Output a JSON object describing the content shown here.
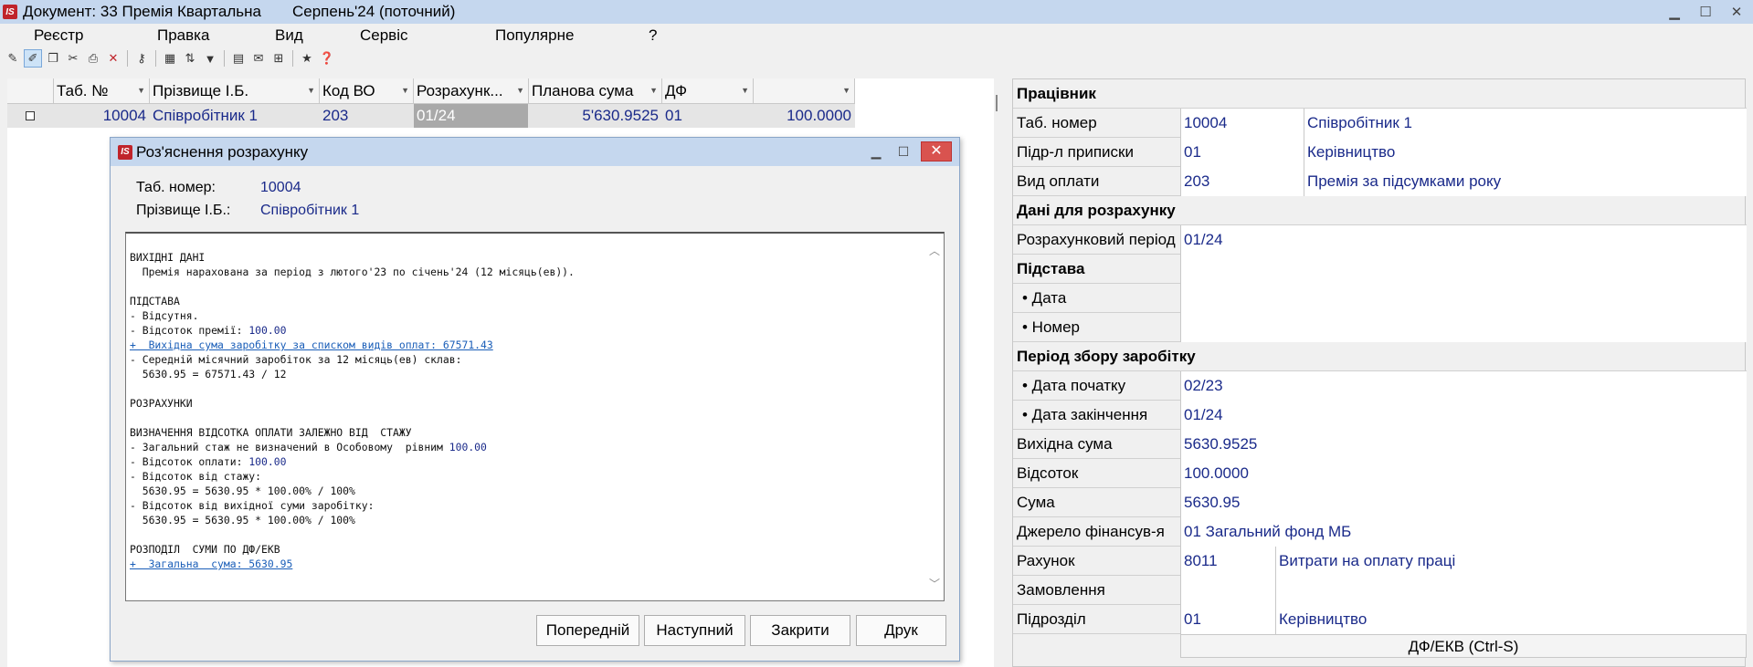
{
  "window": {
    "title": "Документ: 33 Премія Квартальна",
    "period": "Серпень'24 (поточний)",
    "logo_text": "IS"
  },
  "menu": [
    "Реєстр",
    "Правка",
    "Вид",
    "Сервіс",
    "Популярне",
    "?"
  ],
  "grid": {
    "headers": [
      "Таб. №",
      "Прізвище І.Б.",
      "Код ВО",
      "Розрахунк...",
      "Планова сума",
      "ДФ",
      ""
    ],
    "row": {
      "tab": "10004",
      "name": "Співробітник 1",
      "code": "203",
      "period": "01/24",
      "sum": "5'630.9525",
      "df": "01",
      "percent": "100.0000"
    }
  },
  "dialog": {
    "title": "Роз'яснення розрахунку",
    "tab_label": "Таб. номер:",
    "tab_value": "10004",
    "name_label": "Прізвище І.Б.:",
    "name_value": "Співробітник 1",
    "lines": [
      {
        "t": "ВИХІДНІ ДАНІ"
      },
      {
        "t": "  Премія нарахована за період з лютого'23 по січень'24 (12 місяць(ев))."
      },
      {
        "t": ""
      },
      {
        "t": "ПІДСТАВА"
      },
      {
        "t": "- Відсутня."
      },
      {
        "t": "- Відсоток премії: ",
        "n": "100.00"
      },
      {
        "t": "+  Вихідна сума заробітку за списком видів оплат: 67571.43",
        "link": true
      },
      {
        "t": "- Середній місячний заробіток за 12 місяць(ев) склав:"
      },
      {
        "t": "  5630.95 = 67571.43 / 12"
      },
      {
        "t": ""
      },
      {
        "t": "РОЗРАХУНКИ"
      },
      {
        "t": ""
      },
      {
        "t": "ВИЗНАЧЕННЯ ВІДСОТКА ОПЛАТИ ЗАЛЕЖНО ВІД  СТАЖУ"
      },
      {
        "t": "- Загальний стаж не визначений в Особовому  рівним ",
        "n": "100.00"
      },
      {
        "t": "- Відсоток оплати: ",
        "n": "100.00"
      },
      {
        "t": "- Відсоток від стажу:"
      },
      {
        "t": "  5630.95 = 5630.95 * 100.00% / 100%"
      },
      {
        "t": "- Відсоток від вихідної суми заробітку:"
      },
      {
        "t": "  5630.95 = 5630.95 * 100.00% / 100%"
      },
      {
        "t": ""
      },
      {
        "t": "РОЗПОДІЛ  СУМИ ПО ДФ/ЕКВ"
      },
      {
        "t": "+  Загальна  сума: 5630.95",
        "link": true
      }
    ],
    "buttons": {
      "prev": "Попередній",
      "next": "Наступний",
      "close": "Закрити",
      "print": "Друк"
    }
  },
  "panel": {
    "s_employee": "Працівник",
    "tab_label": "Таб. номер",
    "tab_code": "10004",
    "tab_name": "Співробітник 1",
    "dept_label": "Підр-л приписки",
    "dept_code": "01",
    "dept_name": "Керівництво",
    "pay_label": "Вид оплати",
    "pay_code": "203",
    "pay_name": "Премія за підсумками року",
    "s_calc": "Дані для розрахунку",
    "calc_period_label": "Розрахунковий період",
    "calc_period": "01/24",
    "s_basis": "Підстава",
    "date_label": "• Дата",
    "number_label": "• Номер",
    "s_collect": "Період збору заробітку",
    "start_label": "• Дата початку",
    "start_value": "02/23",
    "end_label": "• Дата закінчення",
    "end_value": "01/24",
    "base_sum_label": "Вихідна сума",
    "base_sum": "5630.9525",
    "percent_label": "Відсоток",
    "percent": "100.0000",
    "sum_label": "Сума",
    "sum": "5630.95",
    "fund_label": "Джерело фінансув-я",
    "fund": "01 Загальний фонд МБ",
    "account_label": "Рахунок",
    "account_code": "8011",
    "account_name": "Витрати на оплату праці",
    "order_label": "Замовлення",
    "unit_label": "Підрозділ",
    "unit_code": "01",
    "unit_name": "Керівництво",
    "dfekv_button": "ДФ/ЕКВ (Ctrl-S)"
  }
}
